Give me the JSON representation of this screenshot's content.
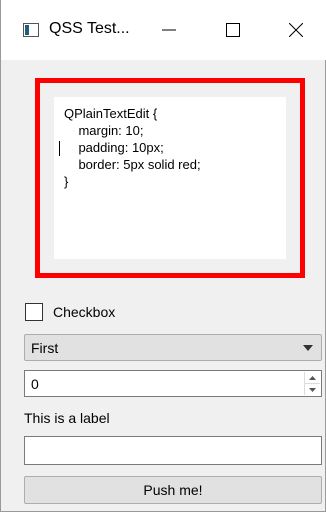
{
  "window": {
    "title": "QSS Test...",
    "icon": "app-window-icon"
  },
  "controls": {
    "minimize": "minimize-icon",
    "maximize": "maximize-icon",
    "close": "close-icon"
  },
  "text_edit": {
    "border_color": "#ff0000",
    "lines": [
      "QPlainTextEdit {",
      "    margin: 10;",
      "    padding: 10px;",
      "    border: 5px solid red;",
      "}"
    ]
  },
  "checkbox": {
    "label": "Checkbox",
    "checked": false
  },
  "combobox": {
    "selected": "First"
  },
  "spinbox": {
    "value": "0"
  },
  "label": {
    "text": "This is a label"
  },
  "line_edit": {
    "value": ""
  },
  "push_button": {
    "label": "Push me!"
  }
}
